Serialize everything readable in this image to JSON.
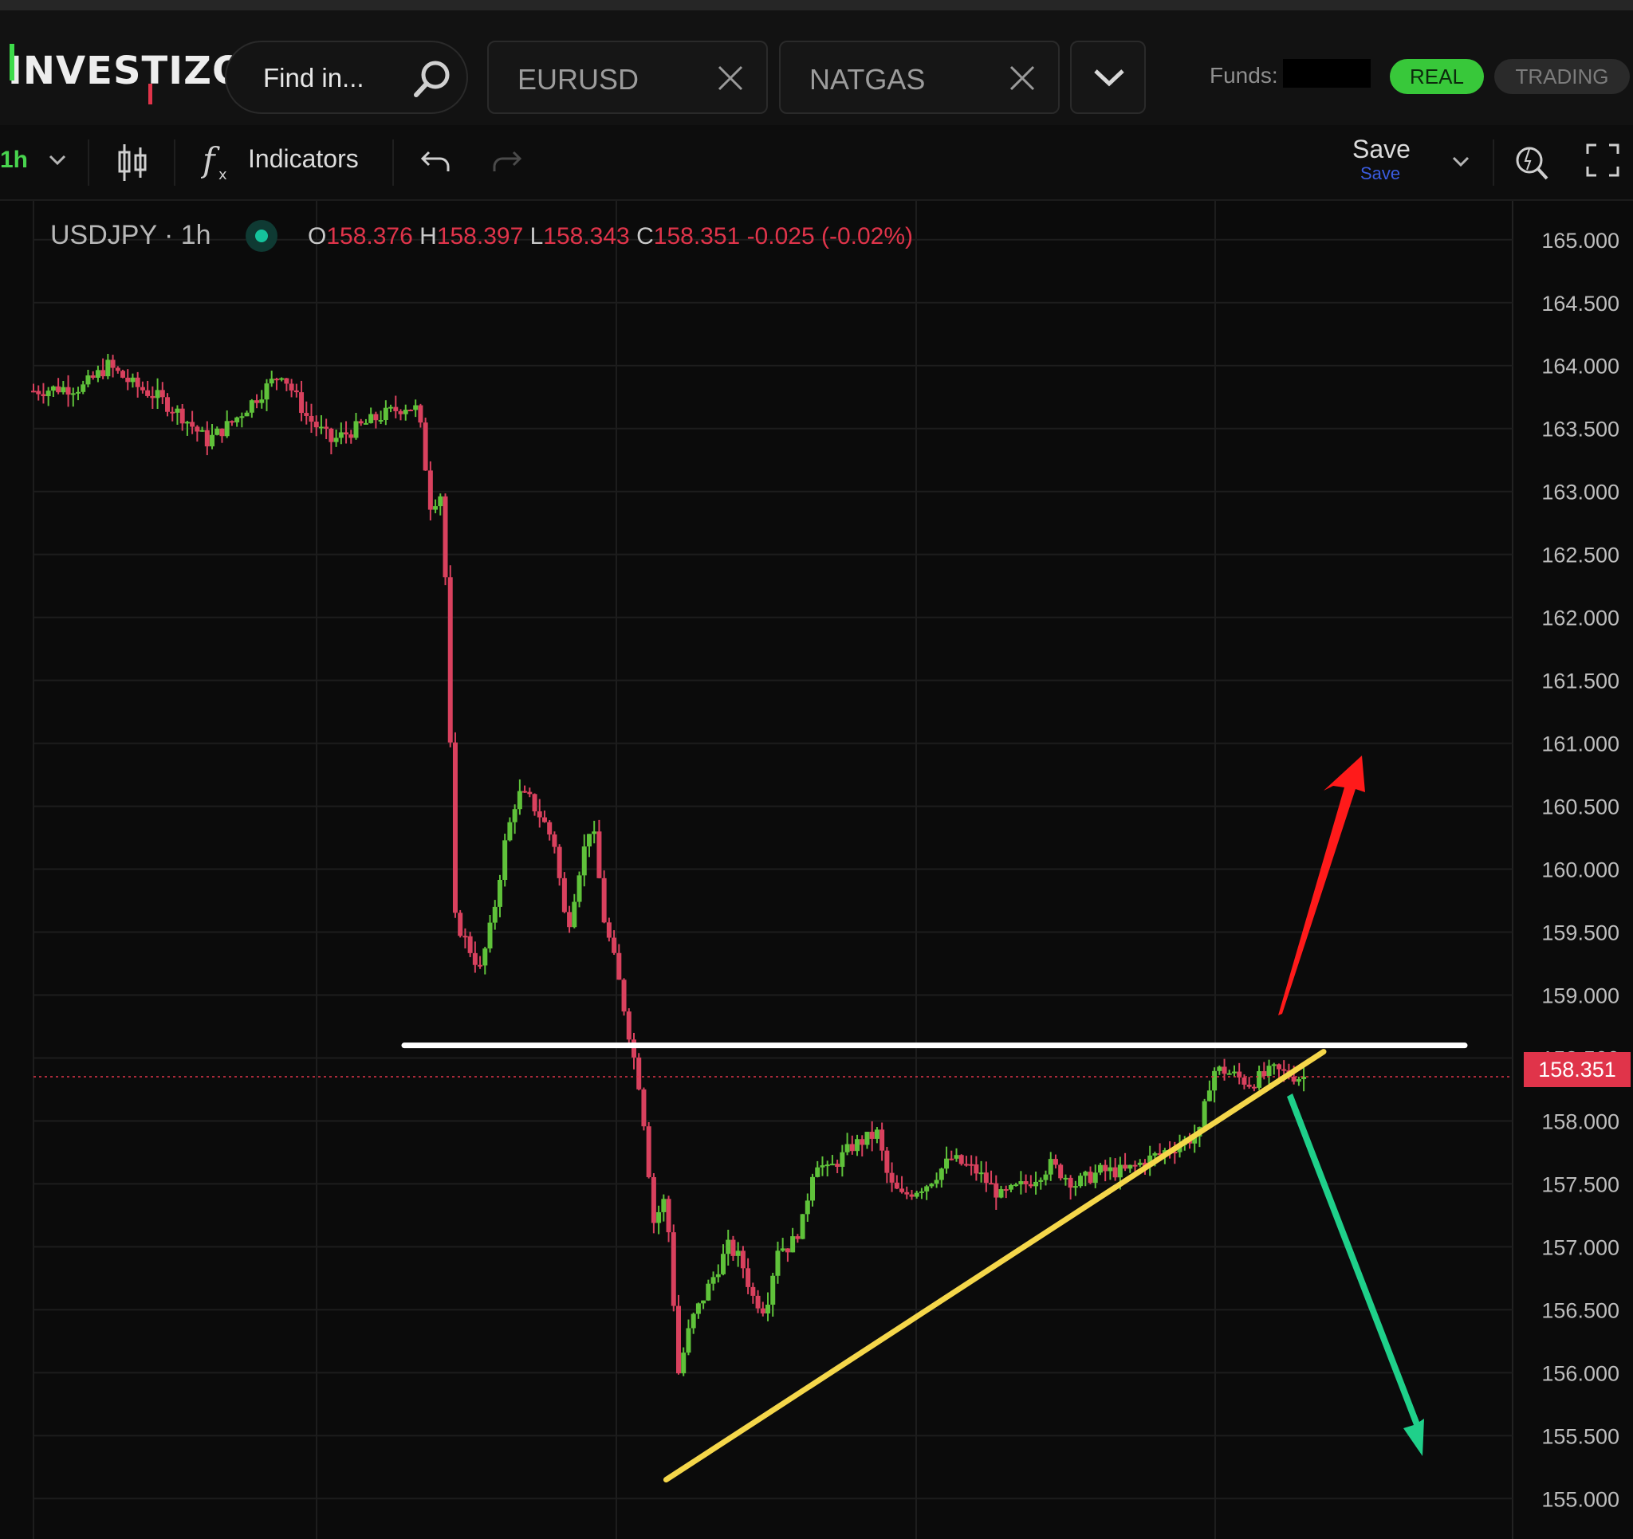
{
  "header": {
    "logo_text": "INVESTIZO",
    "search_placeholder": "Find in...",
    "tabs": [
      {
        "label": "EURUSD"
      },
      {
        "label": "NATGAS"
      }
    ],
    "funds_label": "Funds:",
    "real_label": "REAL",
    "trading_label": "TRADING"
  },
  "toolbar": {
    "timeframe": "1h",
    "indicators_label": "Indicators",
    "save_label": "Save",
    "save_sub": "Save"
  },
  "chart": {
    "symbol": "USDJPY · 1h",
    "ohlc": {
      "o_label": "O",
      "o": "158.376",
      "h_label": "H",
      "h": "158.397",
      "l_label": "L",
      "l": "158.343",
      "c_label": "C",
      "c": "158.351",
      "change": "-0.025 (-0.02%)"
    },
    "last_price": "158.351",
    "colors": {
      "up": "#5fc23a",
      "down": "#d9415e",
      "last": "#e0344a"
    }
  },
  "chart_data": {
    "type": "candlestick",
    "title": "USDJPY · 1h",
    "y_ticks": [
      "165.000",
      "164.500",
      "164.000",
      "163.500",
      "163.000",
      "162.500",
      "162.000",
      "161.500",
      "161.000",
      "160.500",
      "160.000",
      "159.500",
      "159.000",
      "158.500",
      "158.000",
      "157.500",
      "157.000",
      "156.500",
      "156.000",
      "155.500",
      "155.000"
    ],
    "ylim": [
      154.85,
      165.1
    ],
    "grid": true,
    "close_path": [
      [
        0,
        163.8
      ],
      [
        10,
        163.82
      ],
      [
        20,
        163.83
      ],
      [
        30,
        164.0
      ],
      [
        40,
        163.85
      ],
      [
        50,
        163.75
      ],
      [
        60,
        163.6
      ],
      [
        70,
        163.4
      ],
      [
        80,
        163.55
      ],
      [
        90,
        163.75
      ],
      [
        100,
        163.95
      ],
      [
        110,
        163.6
      ],
      [
        120,
        163.4
      ],
      [
        130,
        163.5
      ],
      [
        140,
        163.6
      ],
      [
        150,
        163.68
      ],
      [
        155,
        163.65
      ],
      [
        160,
        162.9
      ],
      [
        165,
        163.0
      ],
      [
        170,
        159.6
      ],
      [
        175,
        159.4
      ],
      [
        180,
        159.2
      ],
      [
        185,
        159.6
      ],
      [
        190,
        160.2
      ],
      [
        195,
        160.6
      ],
      [
        200,
        160.55
      ],
      [
        205,
        160.4
      ],
      [
        210,
        160.2
      ],
      [
        215,
        159.5
      ],
      [
        220,
        160.0
      ],
      [
        225,
        160.4
      ],
      [
        230,
        159.6
      ],
      [
        235,
        159.2
      ],
      [
        240,
        158.7
      ],
      [
        245,
        158.2
      ],
      [
        250,
        157.2
      ],
      [
        255,
        157.4
      ],
      [
        260,
        156.0
      ],
      [
        265,
        156.4
      ],
      [
        270,
        156.6
      ],
      [
        275,
        156.8
      ],
      [
        280,
        157.0
      ],
      [
        285,
        156.9
      ],
      [
        290,
        156.6
      ],
      [
        295,
        156.5
      ],
      [
        300,
        157.0
      ],
      [
        305,
        157.0
      ],
      [
        310,
        157.2
      ],
      [
        315,
        157.7
      ],
      [
        320,
        157.6
      ],
      [
        330,
        157.8
      ],
      [
        340,
        157.9
      ],
      [
        345,
        157.5
      ],
      [
        350,
        157.4
      ],
      [
        360,
        157.5
      ],
      [
        370,
        157.7
      ],
      [
        380,
        157.6
      ],
      [
        390,
        157.4
      ],
      [
        400,
        157.5
      ],
      [
        410,
        157.65
      ],
      [
        420,
        157.5
      ],
      [
        430,
        157.6
      ],
      [
        440,
        157.6
      ],
      [
        450,
        157.7
      ],
      [
        460,
        157.8
      ],
      [
        470,
        157.9
      ],
      [
        475,
        158.4
      ],
      [
        480,
        158.4
      ],
      [
        490,
        158.3
      ],
      [
        500,
        158.4
      ],
      [
        510,
        158.35
      ]
    ],
    "annotations": [
      {
        "type": "horizontal_line",
        "price": 158.6,
        "color": "#ffffff"
      },
      {
        "type": "trend_line",
        "from": [
          255,
          155.15
        ],
        "to": [
          520,
          158.55
        ],
        "color": "#f5d74a"
      },
      {
        "type": "arrow",
        "direction": "up",
        "color": "#ff1a1a"
      },
      {
        "type": "arrow",
        "direction": "down",
        "color": "#1fd08a"
      }
    ]
  }
}
